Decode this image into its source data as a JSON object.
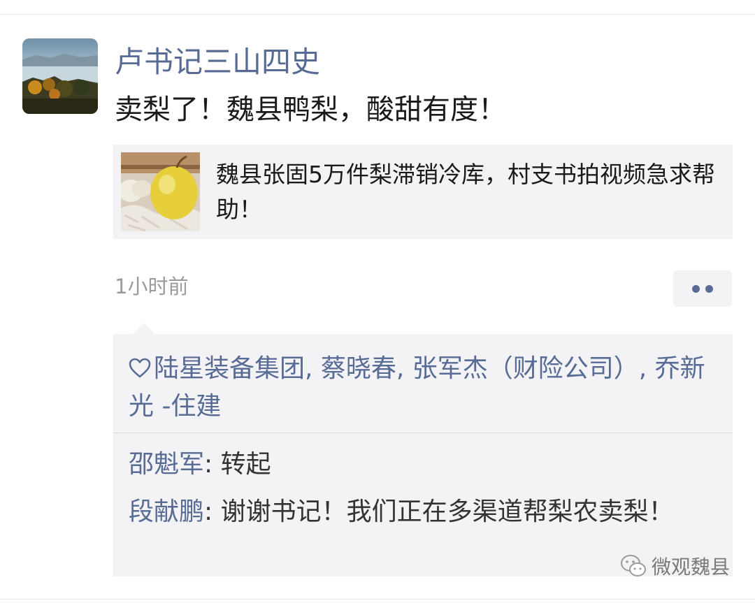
{
  "post": {
    "author": "卢书记三山四史",
    "text": "卖梨了！魏县鸭梨，酸甜有度！",
    "timestamp": "1小时前"
  },
  "link_card": {
    "title": "魏县张固5万件梨滞销冷库，村支书拍视频急求帮助！",
    "thumbnail_icon": "pear-photo"
  },
  "likes": {
    "icon": "heart-icon",
    "names": "陆星装备集团, 蔡晓春, 张军杰（财险公司）, 乔新光 -住建"
  },
  "comments": [
    {
      "author": "邵魁军",
      "separator": ": ",
      "text": "转起"
    },
    {
      "author": "段献鹏",
      "separator": ": ",
      "text": "谢谢书记！我们正在多渠道帮梨农卖梨！"
    }
  ],
  "watermark": {
    "icon": "wechat-icon",
    "text": "微观魏县"
  },
  "colors": {
    "link_blue": "#576b95",
    "panel_bg": "#f3f3f5",
    "text_main": "#1a1a1a",
    "text_muted": "#9b9b9b"
  }
}
